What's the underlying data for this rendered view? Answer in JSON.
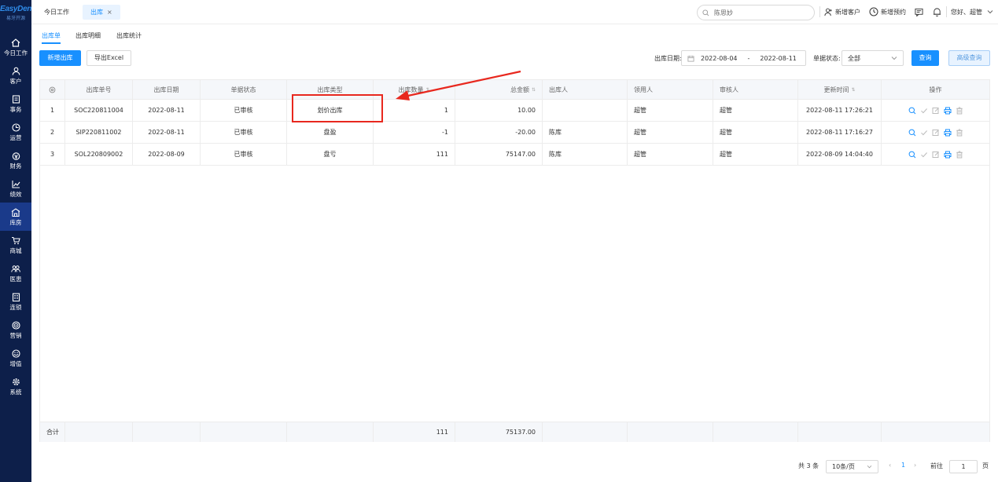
{
  "app": {
    "logo_text": "EasyDent",
    "logo_sub": "易牙开源"
  },
  "sidebar": {
    "items": [
      {
        "label": "今日工作",
        "icon": "home-icon"
      },
      {
        "label": "客户",
        "icon": "user-icon"
      },
      {
        "label": "事务",
        "icon": "task-icon"
      },
      {
        "label": "运营",
        "icon": "clock-icon"
      },
      {
        "label": "财务",
        "icon": "money-icon"
      },
      {
        "label": "绩效",
        "icon": "chart-icon"
      },
      {
        "label": "库房",
        "icon": "warehouse-icon",
        "active": true
      },
      {
        "label": "商城",
        "icon": "cart-icon"
      },
      {
        "label": "医患",
        "icon": "people-icon"
      },
      {
        "label": "连锁",
        "icon": "building-icon"
      },
      {
        "label": "营销",
        "icon": "target-icon"
      },
      {
        "label": "增值",
        "icon": "gift-icon"
      },
      {
        "label": "系统",
        "icon": "gear-icon"
      }
    ]
  },
  "topbar": {
    "tabs": [
      {
        "label": "今日工作"
      },
      {
        "label": "出库",
        "close": "×"
      }
    ],
    "search": {
      "value": "陈思妙"
    },
    "new_customer": "新增客户",
    "new_appointment": "新增预约",
    "greeting": "您好、超管"
  },
  "subtabs": [
    "出库单",
    "出库明细",
    "出库统计"
  ],
  "toolbar": {
    "new_btn": "新增出库",
    "export_btn": "导出Excel",
    "date_label": "出库日期:",
    "date_start": "2022-08-04",
    "date_sep": "-",
    "date_end": "2022-08-11",
    "status_label": "单据状态:",
    "status_value": "全部",
    "query_btn": "查询",
    "advanced_btn": "高级查询"
  },
  "table": {
    "columns": [
      "出库单号",
      "出库日期",
      "单据状态",
      "出库类型",
      "出库数量",
      "总金额",
      "出库人",
      "领用人",
      "审核人",
      "更新时间",
      "操作"
    ],
    "rows": [
      {
        "idx": "1",
        "no": "SOC220811004",
        "date": "2022-08-11",
        "status": "已审核",
        "type": "划价出库",
        "qty": "1",
        "amount": "10.00",
        "out": "",
        "taker": "超管",
        "auditor": "超管",
        "updated": "2022-08-11 17:26:21"
      },
      {
        "idx": "2",
        "no": "SIP220811002",
        "date": "2022-08-11",
        "status": "已审核",
        "type": "盘盈",
        "qty": "-1",
        "amount": "-20.00",
        "out": "陈库",
        "taker": "超管",
        "auditor": "超管",
        "updated": "2022-08-11 17:16:27"
      },
      {
        "idx": "3",
        "no": "SOL220809002",
        "date": "2022-08-09",
        "status": "已审核",
        "type": "盘亏",
        "qty": "111",
        "amount": "75147.00",
        "out": "陈库",
        "taker": "超管",
        "auditor": "超管",
        "updated": "2022-08-09 14:04:40"
      }
    ],
    "footer": {
      "label": "合计",
      "qty": "111",
      "amount": "75137.00"
    }
  },
  "pager": {
    "total": "共 3 条",
    "page_size": "10条/页",
    "current": "1",
    "prev": "‹",
    "next": "›",
    "goto_label": "前往",
    "goto_value": "1",
    "goto_suffix": "页"
  },
  "colors": {
    "primary": "#1890ff",
    "sidebar_bg": "#0d1f4a",
    "annotation": "#e8281e"
  }
}
